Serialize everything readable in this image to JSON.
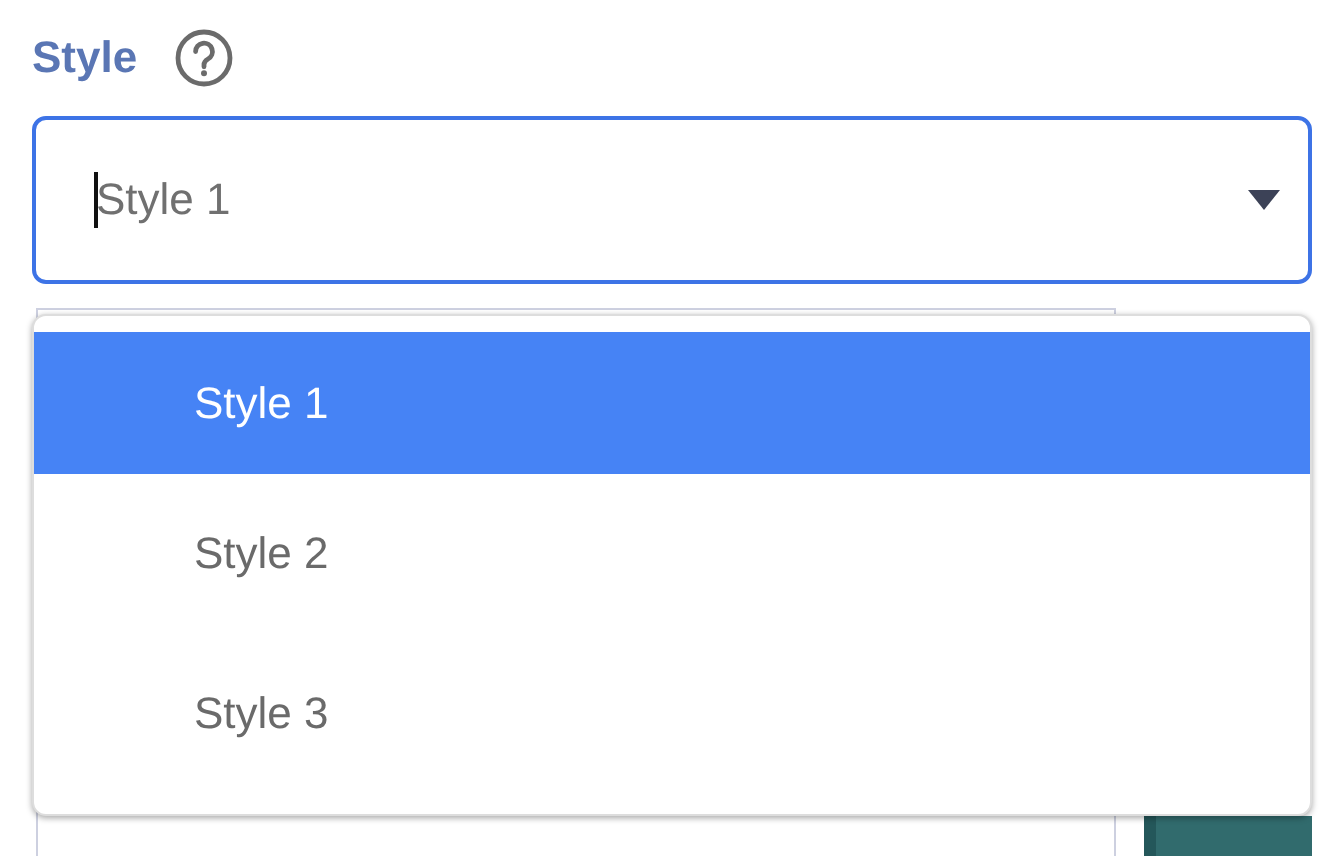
{
  "field": {
    "label": "Style",
    "placeholder": "Style 1",
    "focused": true,
    "open": true
  },
  "options": [
    {
      "label": "Style 1",
      "selected": true
    },
    {
      "label": "Style 2",
      "selected": false
    },
    {
      "label": "Style 3",
      "selected": false
    }
  ]
}
